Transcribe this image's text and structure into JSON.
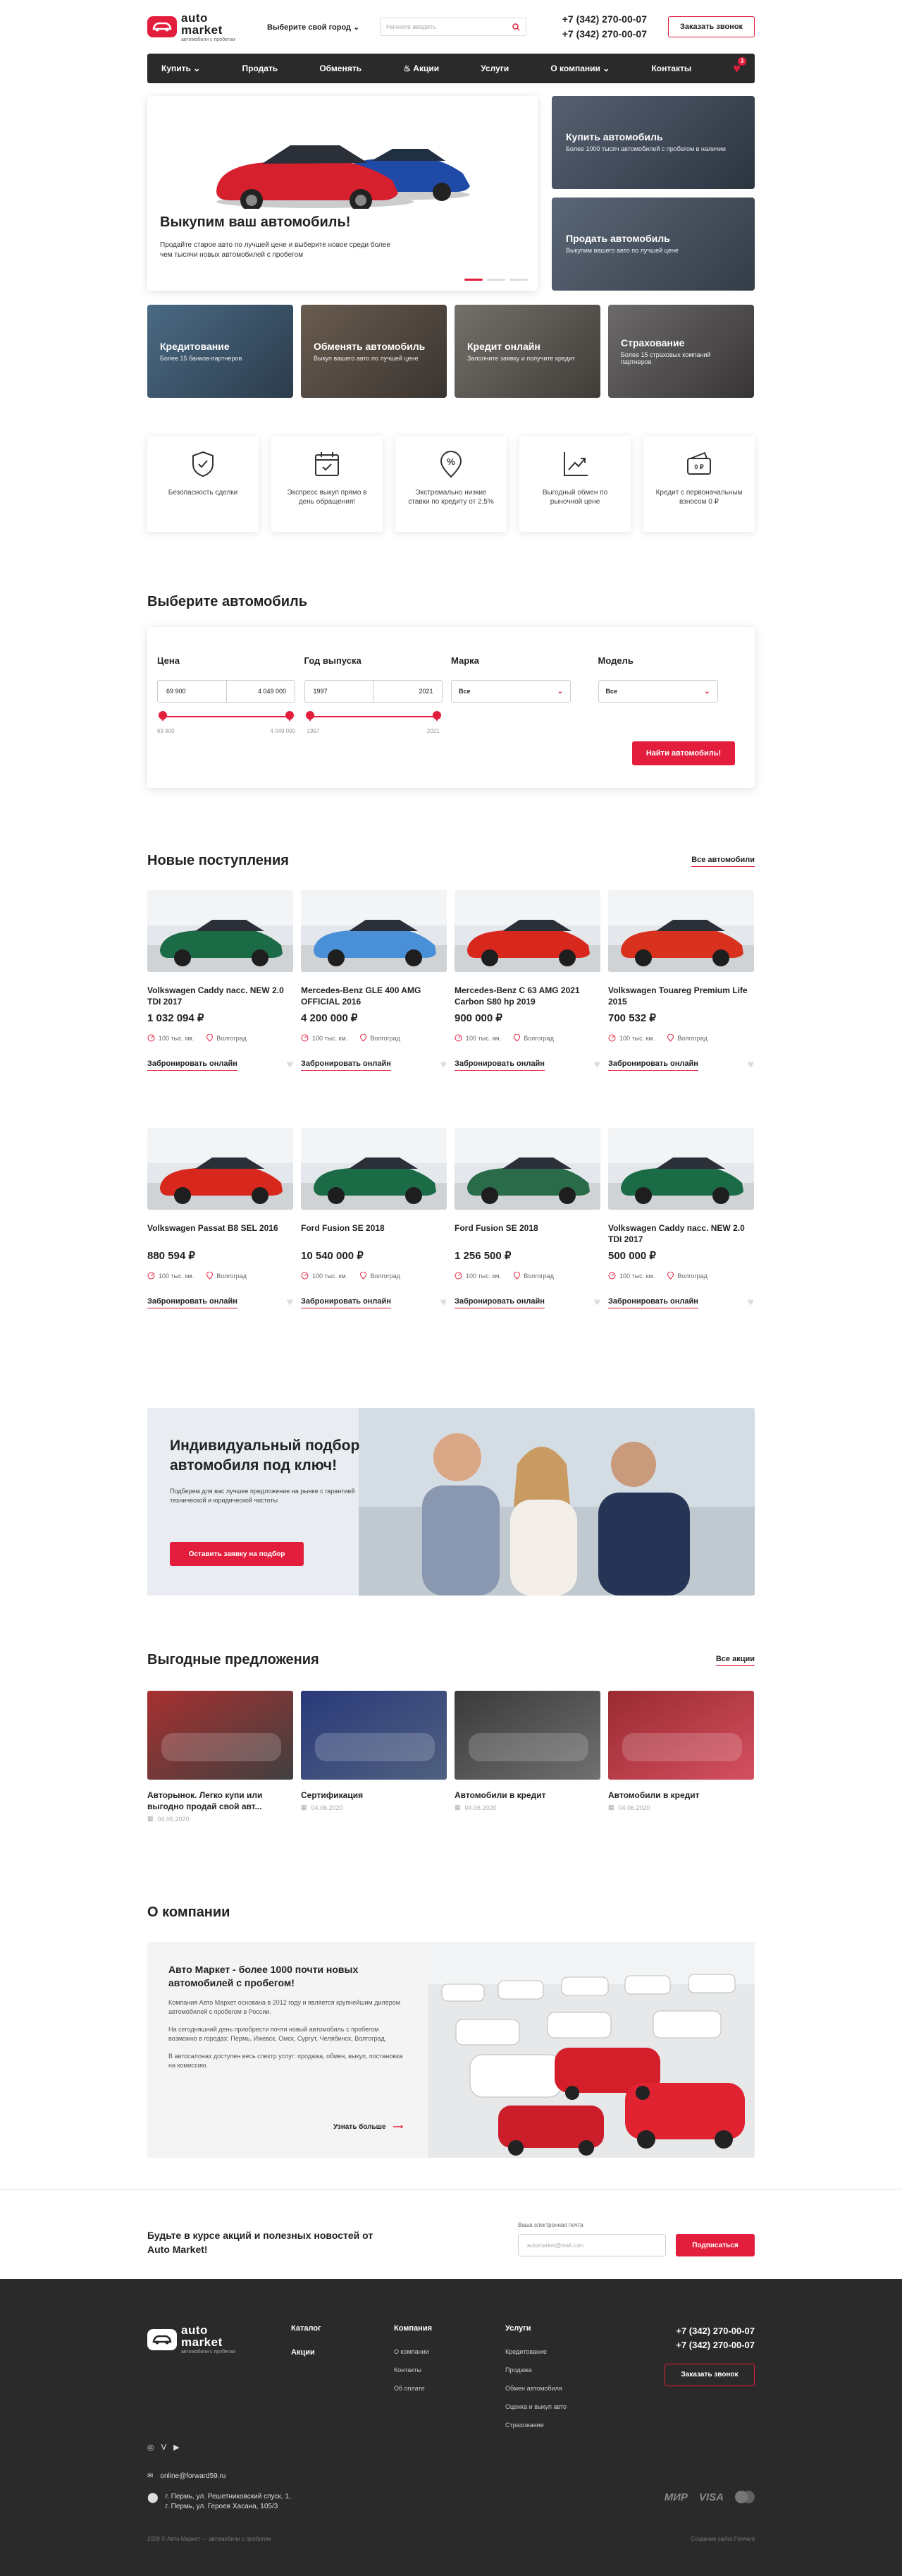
{
  "header": {
    "logo_auto": "auto",
    "logo_market": "market",
    "logo_sub": "автомобили с пробегом",
    "city_label": "Выберите свой город",
    "search_placeholder": "Начните вводить",
    "phone1": "+7 (342) 270-00-07",
    "phone2": "+7 (342) 270-00-07",
    "callback": "Заказать звонок"
  },
  "nav": {
    "items": [
      "Купить",
      "Продать",
      "Обменять",
      "Акции",
      "Услуги",
      "О компании",
      "Контакты"
    ],
    "fav_count": "3"
  },
  "hero": {
    "title": "Выкупим ваш автомобиль!",
    "text": "Продайте старое авто по лучшей цене и выберите новое среди более чем тысячи новых автомобилей с пробегом",
    "side": [
      {
        "title": "Купить автомобиль",
        "text": "Более 1000 тысяч автомобилей с пробегом в наличии"
      },
      {
        "title": "Продать автомобиль",
        "text": "Выкупим вашего авто по лучшей цене"
      }
    ]
  },
  "services": [
    {
      "title": "Кредитование",
      "text": "Более 15 банков-партнеров"
    },
    {
      "title": "Обменять автомобиль",
      "text": "Выкуп вашего авто по лучшей цене"
    },
    {
      "title": "Кредит онлайн",
      "text": "Заполните заявку и получите кредит"
    },
    {
      "title": "Страхование",
      "text": "Более 15 страховых компаний партнеров"
    }
  ],
  "features": [
    {
      "icon": "shield-check-icon",
      "text": "Безопасность сделки"
    },
    {
      "icon": "calendar-check-icon",
      "text": "Экспресс выкуп прямо в день обращения!"
    },
    {
      "icon": "percent-badge-icon",
      "text": "Экстремально низкие ставки по кредиту от 2,5%"
    },
    {
      "icon": "growth-chart-icon",
      "text": "Выгодный обмен по рыночной цене"
    },
    {
      "icon": "wallet-card-icon",
      "text": "Кредит с первоначальным взносом 0 ₽"
    }
  ],
  "filter": {
    "title": "Выберите автомобиль",
    "price_label": "Цена",
    "price_from": "69 900",
    "price_to": "4 049 000",
    "year_label": "Год выпуска",
    "year_from": "1997",
    "year_to": "2021",
    "brand_label": "Марка",
    "brand_value": "Все",
    "model_label": "Модель",
    "model_value": "Все",
    "submit": "Найти автомобиль!"
  },
  "new_arrivals": {
    "title": "Новые поступления",
    "all_link": "Все автомобили",
    "reserve": "Забронировать онлайн",
    "cars": [
      {
        "name": "Volkswagen Caddy пасс. NEW 2.0 TDI 2017",
        "price": "1 032 094 ₽",
        "mileage": "100 тыс. км.",
        "city": "Волгоград",
        "color": "#1c6b47"
      },
      {
        "name": "Mercedes-Benz GLE 400 AMG OFFICIAL 2016",
        "price": "4 200 000 ₽",
        "mileage": "100 тыс. км.",
        "city": "Волгоград",
        "color": "#4a90d9"
      },
      {
        "name": "Mercedes-Benz C 63 AMG 2021 Carbon S80 hp 2019",
        "price": "900 000 ₽",
        "mileage": "100 тыс. км.",
        "city": "Волгоград",
        "color": "#d8281e"
      },
      {
        "name": "Volkswagen Touareg Premium Life 2015",
        "price": "700 532 ₽",
        "mileage": "100 тыс. км.",
        "city": "Волгоград",
        "color": "#d8321e"
      },
      {
        "name": "Volkswagen Passat B8 SEL 2016",
        "price": "880 594 ₽",
        "mileage": "100 тыс. км.",
        "city": "Волгоград",
        "color": "#d8281e"
      },
      {
        "name": "Ford Fusion SE 2018",
        "price": "10 540 000 ₽",
        "mileage": "100 тыс. км.",
        "city": "Волгоград",
        "color": "#1c6b47"
      },
      {
        "name": "Ford Fusion SE 2018",
        "price": "1 256 500 ₽",
        "mileage": "100 тыс. км.",
        "city": "Волгоград",
        "color": "#2a6b4a"
      },
      {
        "name": "Volkswagen Caddy пасс. NEW 2.0 TDI 2017",
        "price": "500 000 ₽",
        "mileage": "100 тыс. км.",
        "city": "Волгоград",
        "color": "#1c6b47"
      }
    ]
  },
  "promo": {
    "title": "Индивидуальный подбор автомобиля под ключ!",
    "text": "Подберем для вас лучшее предложение на рынке с гарантией технической и юридической чистоты",
    "button": "Оставить заявку на подбор"
  },
  "offers": {
    "title": "Выгодные предложения",
    "all_link": "Все акции",
    "items": [
      {
        "title": "Авторынок. Легко купи или выгодно продай свой авт...",
        "date": "04.06.2020"
      },
      {
        "title": "Сертификация",
        "date": "04.06.2020"
      },
      {
        "title": "Автомобили в кредит",
        "date": "04.06.2020"
      },
      {
        "title": "Автомобили в кредит",
        "date": "04.06.2020"
      }
    ]
  },
  "about": {
    "title": "О компании",
    "heading": "Авто Маркет - более 1000 почти новых автомобилей с пробегом!",
    "p1": "Компания Авто Маркет основана в 2012 году и является крупнейшим дилером автомобилей с пробегом в России.",
    "p2": "На сегодняшний день приобрести почти новый автомобиль с пробегом возможно в городах: Пермь, Ижевск, Омск, Сургут, Челябинск, Волгоград.",
    "p3": "В автосалонах доступен весь спектр услуг: продажа, обмен, выкуп, постановка на комиссию.",
    "link": "Узнать больше"
  },
  "subscribe": {
    "title": "Будьте в курсе акций и полезных новостей от Auto Market!",
    "label": "Ваша электронная почта",
    "placeholder": "automarket@mail.com",
    "button": "Подписаться"
  },
  "footer": {
    "col1": [
      "Каталог",
      "Акции"
    ],
    "col2_title": "Компания",
    "col2": [
      "О компании",
      "Контакты",
      "Об оплате"
    ],
    "col3_title": "Услуги",
    "col3": [
      "Кредитование",
      "Продажа",
      "Обмен автомобиля",
      "Оценка и выкуп авто",
      "Страхование"
    ],
    "phone1": "+7 (342) 270-00-07",
    "phone2": "+7 (342) 270-00-07",
    "callback": "Заказать звонок",
    "email": "online@forward59.ru",
    "address1": "г. Пермь, ул. Решетниковский спуск, 1,",
    "address2": "г. Пермь, ул. Героев Хасана, 105/3",
    "copyright": "2020 © Авто Маркет — автомобили с пробегом",
    "dev": "Создание сайта Forward",
    "pay": [
      "МИР",
      "VISA"
    ]
  }
}
